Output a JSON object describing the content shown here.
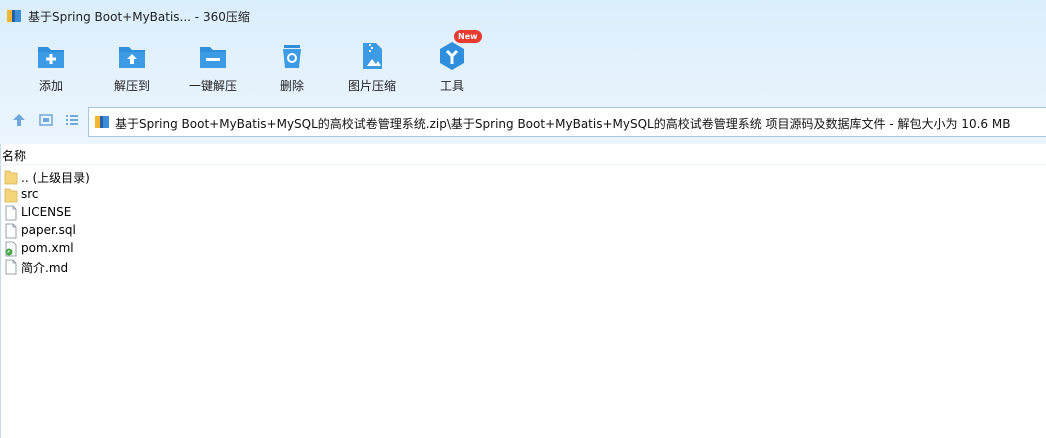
{
  "window": {
    "title": "基于Spring Boot+MyBatis... - 360压缩"
  },
  "toolbar": {
    "buttons": [
      {
        "label": "添加",
        "icon": "add-folder-icon"
      },
      {
        "label": "解压到",
        "icon": "extract-to-icon"
      },
      {
        "label": "一键解压",
        "icon": "one-click-extract-icon"
      },
      {
        "label": "删除",
        "icon": "trash-icon"
      },
      {
        "label": "图片压缩",
        "icon": "image-compress-icon"
      },
      {
        "label": "工具",
        "icon": "tools-icon",
        "badge": "New"
      }
    ]
  },
  "navigation": {
    "path": "基于Spring Boot+MyBatis+MySQL的高校试卷管理系统.zip\\基于Spring Boot+MyBatis+MySQL的高校试卷管理系统 项目源码及数据库文件 - 解包大小为 10.6 MB"
  },
  "list": {
    "column_name": "名称",
    "items": [
      {
        "name": ".. (上级目录)",
        "type": "folder"
      },
      {
        "name": "src",
        "type": "folder"
      },
      {
        "name": "LICENSE",
        "type": "file"
      },
      {
        "name": "paper.sql",
        "type": "file"
      },
      {
        "name": "pom.xml",
        "type": "xml-file"
      },
      {
        "name": "简介.md",
        "type": "file"
      }
    ]
  },
  "colors": {
    "accent": "#2f8fdc",
    "badge": "#e63b2e",
    "toolbar_bg": "#dbeefc"
  }
}
